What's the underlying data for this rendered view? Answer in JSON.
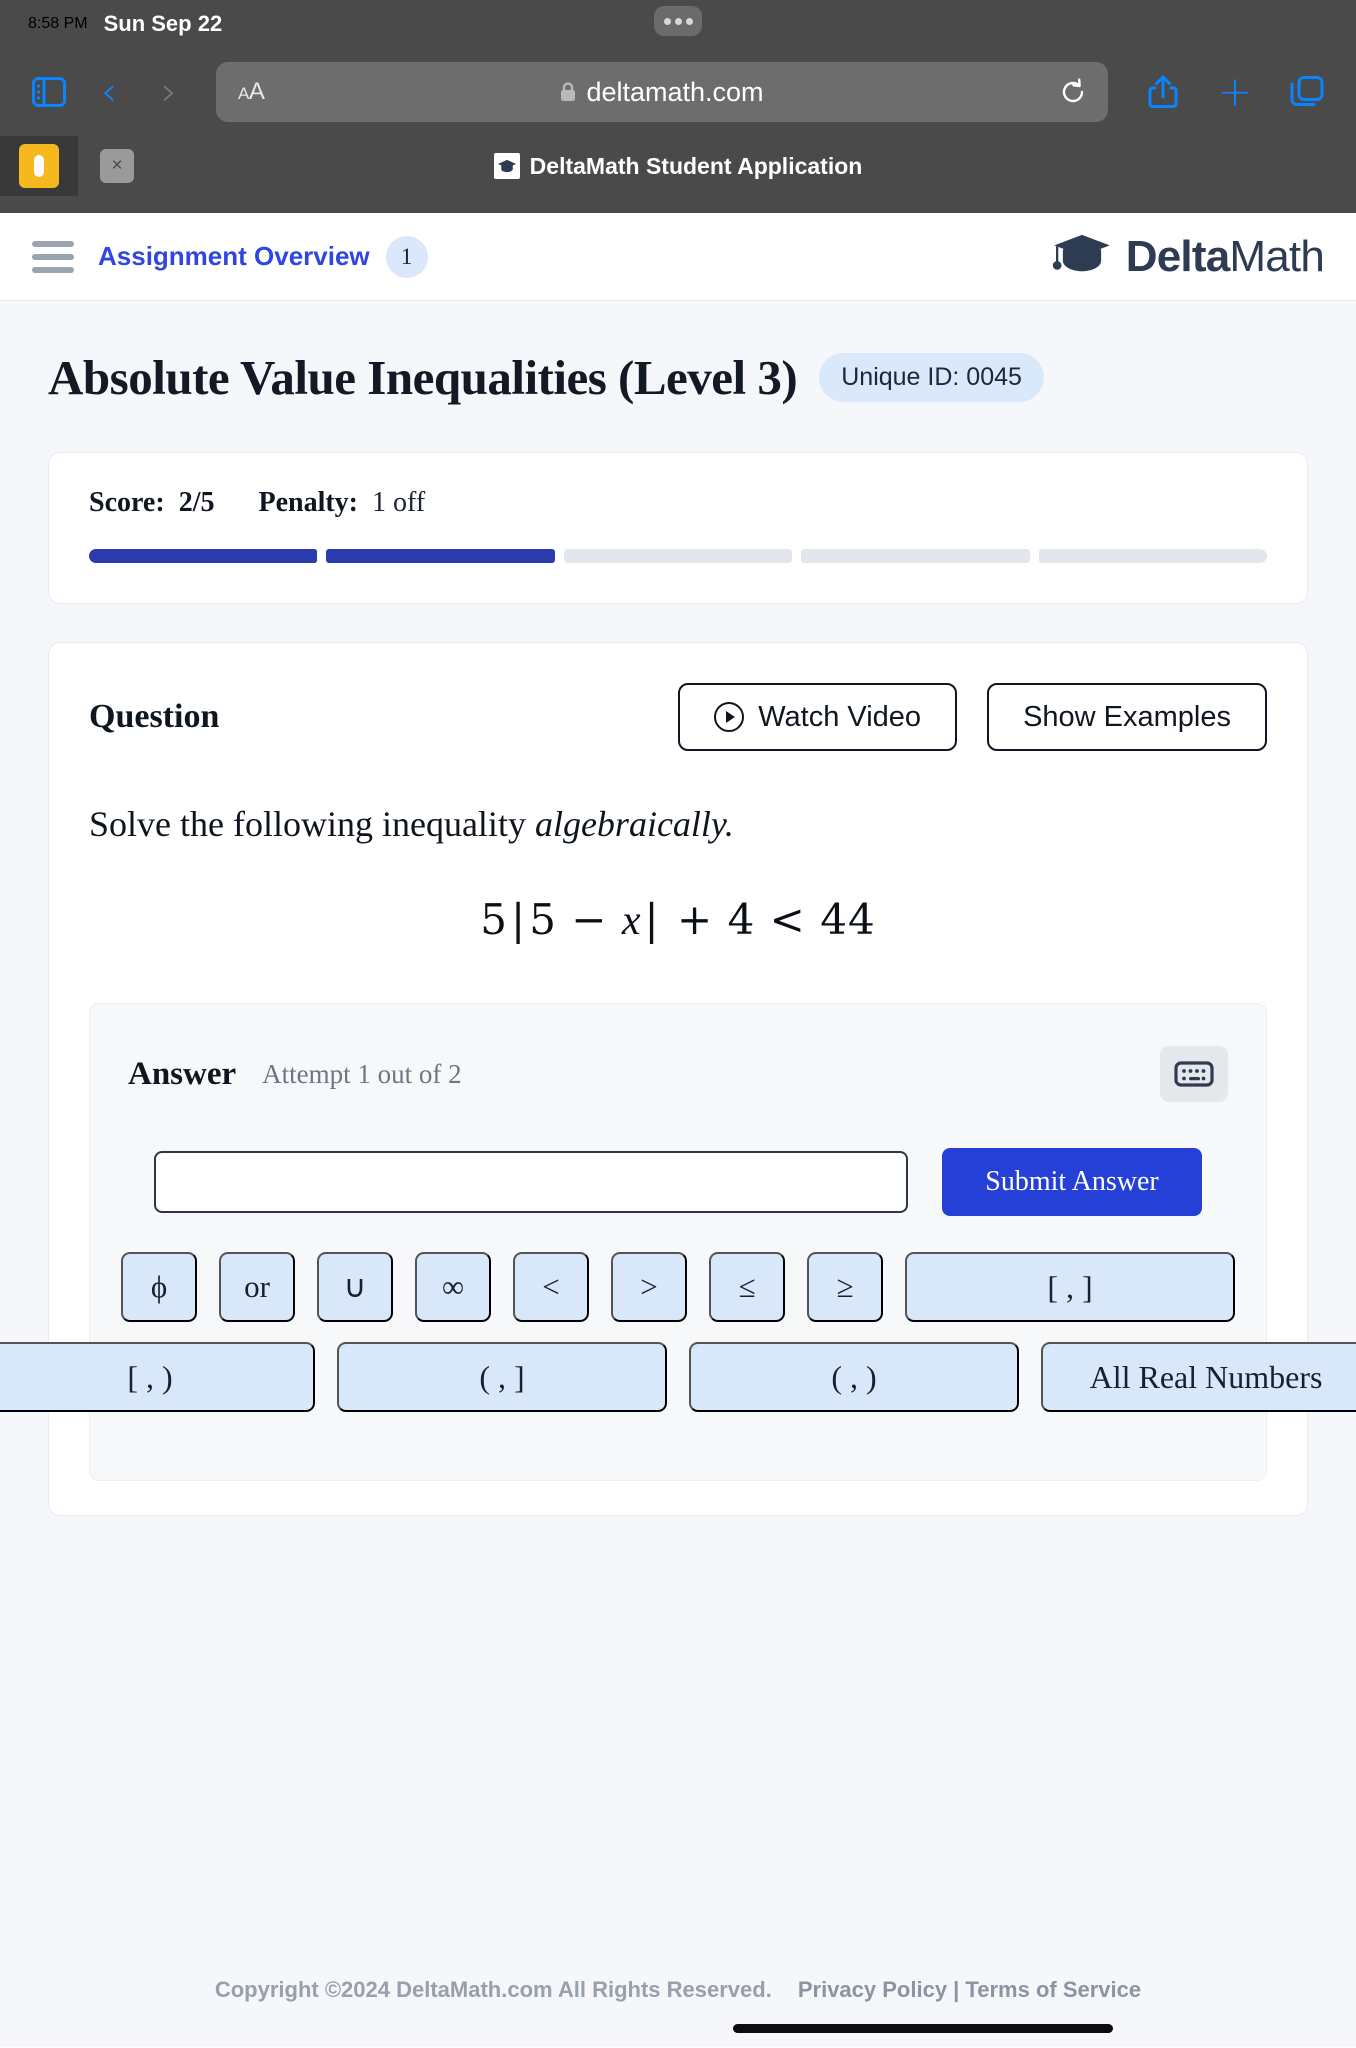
{
  "browser": {
    "status_time": "8:58 PM",
    "status_date": "Sun Sep 22",
    "aa_label_small": "A",
    "aa_label_large": "A",
    "url": "deltamath.com",
    "tab_title": "DeltaMath Student Application",
    "tab_close_label": "×",
    "icons": {
      "sidebar": "sidebar-icon",
      "back": "back-chevron-icon",
      "forward": "forward-chevron-icon",
      "lock": "lock-icon",
      "reload": "reload-icon",
      "share": "share-icon",
      "new_tab": "plus-icon",
      "tabs": "tabs-icon"
    }
  },
  "header": {
    "nav_label": "Assignment Overview",
    "nav_count": "1",
    "brand_bold": "Delta",
    "brand_light": "Math"
  },
  "page": {
    "title": "Absolute Value Inequalities (Level 3)",
    "unique_id": "Unique ID: 0045"
  },
  "score": {
    "score_label": "Score:",
    "score_value": "2/5",
    "penalty_label": "Penalty:",
    "penalty_value": "1 off",
    "segments": [
      true,
      true,
      false,
      false,
      false
    ]
  },
  "question": {
    "label": "Question",
    "watch_video": "Watch Video",
    "show_examples": "Show Examples",
    "prompt_plain": "Solve the following inequality ",
    "prompt_italic": "algebraically.",
    "math": {
      "coefficient": "5",
      "open_bar": "|",
      "inner_left": "5",
      "minus": "−",
      "variable": "x",
      "close_bar": "|",
      "plus": "+",
      "addend": "4",
      "relation": "<",
      "rhs": "44"
    }
  },
  "answer": {
    "label": "Answer",
    "attempt": "Attempt 1 out of 2",
    "keyboard_icon": "keyboard-icon",
    "input_value": "",
    "input_placeholder": "",
    "submit_label": "Submit Answer",
    "symbols_row1": [
      "ϕ",
      "or",
      "∪",
      "∞",
      "<",
      ">",
      "≤",
      "≥",
      "[ , ]"
    ],
    "symbols_row2": [
      "[ , )",
      "( , ]",
      "( , )",
      "All Real Numbers"
    ]
  },
  "footer": {
    "copyright": "Copyright ©2024 DeltaMath.com All Rights Reserved.",
    "links": "Privacy Policy | Terms of Service"
  },
  "colors": {
    "accent_blue": "#2540d6",
    "nav_blue": "#2f46e3",
    "progress_fill": "#2a3cae",
    "badge_blue": "#d9e8fb",
    "brand_navy": "#2d3c52"
  }
}
